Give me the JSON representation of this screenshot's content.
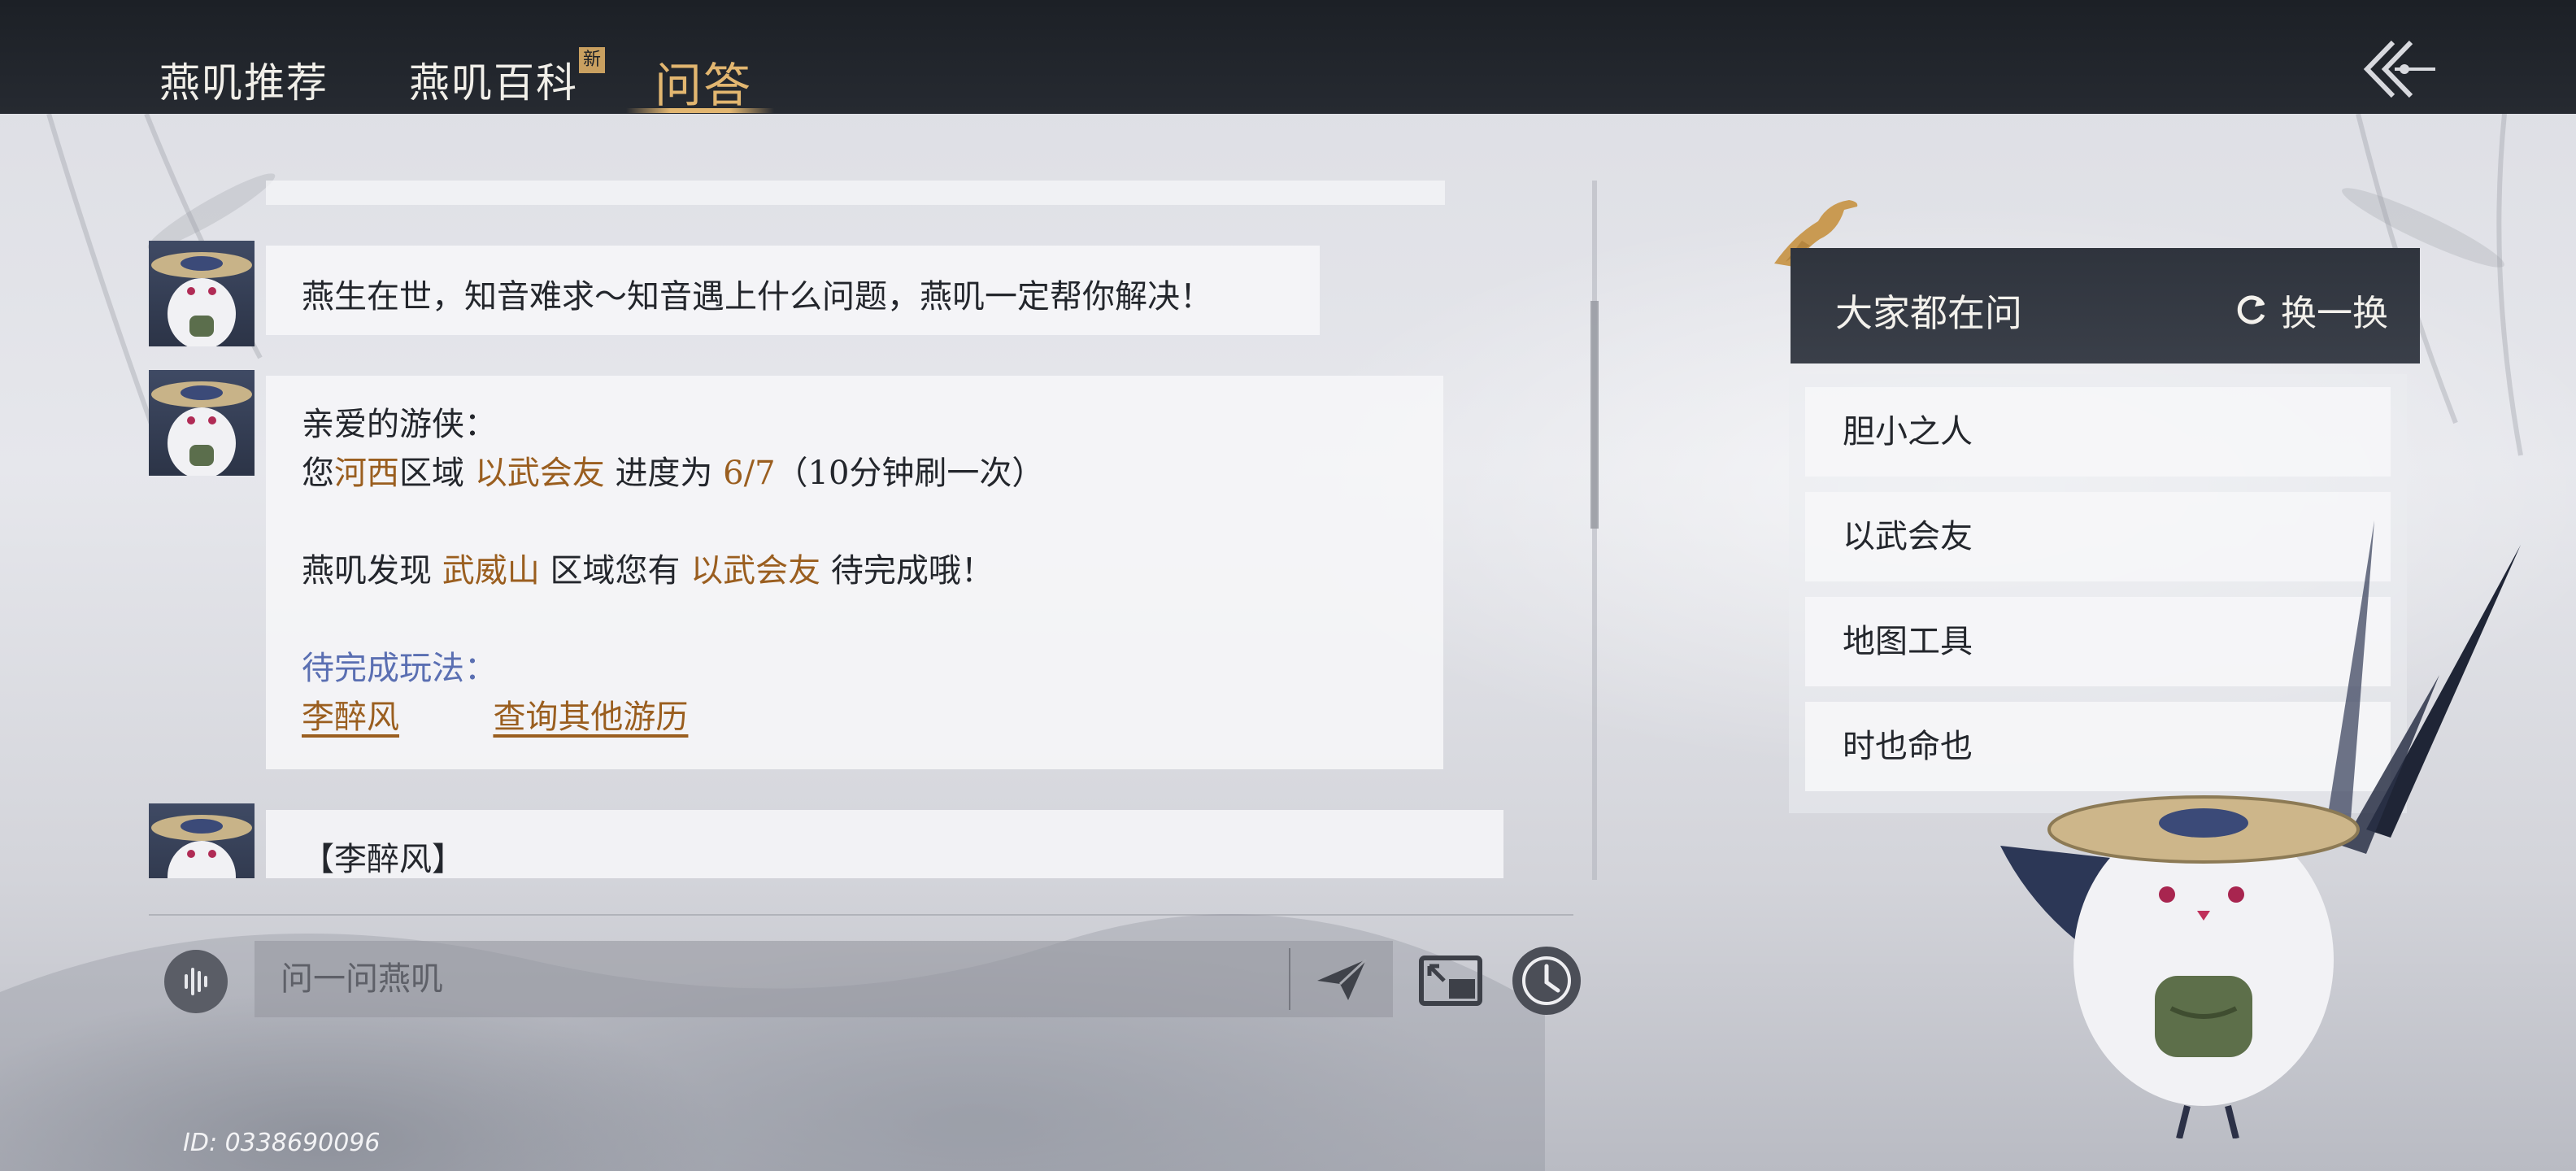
{
  "header": {
    "tabs": [
      {
        "label": "燕叽推荐"
      },
      {
        "label": "燕叽百科",
        "badge": "新"
      },
      {
        "label": "问答",
        "active": true
      }
    ],
    "back_icon": "double-chevron-left-icon"
  },
  "chat": {
    "messages": [
      {
        "text": "燕生在世，知音难求～知音遇上什么问题，燕叽一定帮你解决！"
      },
      {
        "greeting": "亲爱的游侠：",
        "line1": {
          "pre": "您",
          "region": "河西",
          "mid": "区域",
          "activity": "以武会友",
          "mid2": "进度为",
          "progress": "6/7",
          "post": "（10分钟刷一次）"
        },
        "line2": {
          "pre": "燕叽发现",
          "region": "武威山",
          "mid": "区域您有",
          "activity": "以武会友",
          "post": "待完成哦！"
        },
        "pending_label": "待完成玩法：",
        "links": [
          "李醉风",
          "查询其他游历"
        ]
      },
      {
        "text": "【李醉风】"
      }
    ]
  },
  "input_bar": {
    "placeholder": "问一问燕叽",
    "voice_icon": "voice-wave-icon",
    "send_icon": "paper-plane-icon",
    "expand_icon": "window-expand-icon",
    "history_icon": "clock-icon"
  },
  "user_id": "ID: 0338690096",
  "faq": {
    "title": "大家都在问",
    "refresh_label": "换一换",
    "items": [
      "胆小之人",
      "以武会友",
      "地图工具",
      "时也命也"
    ]
  },
  "colors": {
    "accent_gold": "#e2b670",
    "highlight_brown": "#9a5e1f",
    "label_blue": "#5a6fb2",
    "topbar": "#1c2026"
  }
}
